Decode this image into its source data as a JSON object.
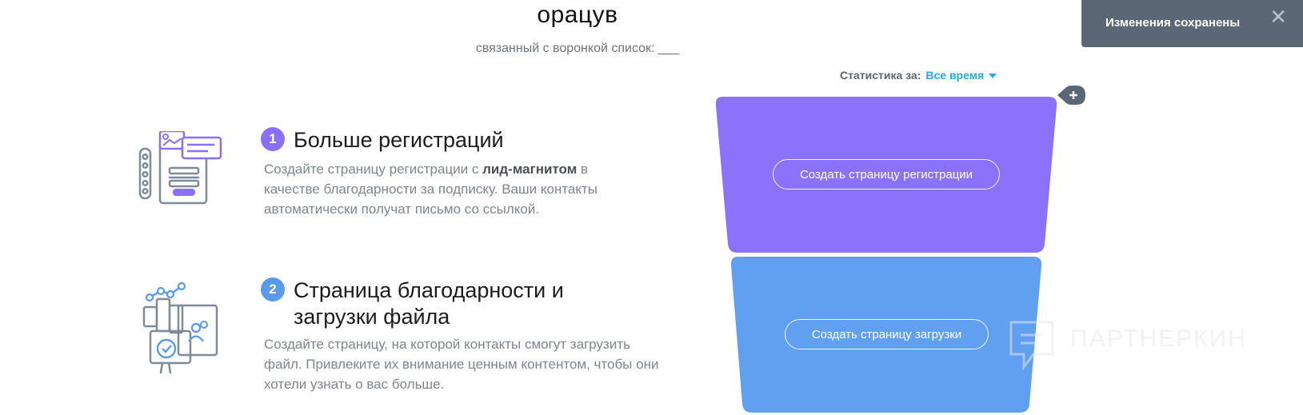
{
  "page": {
    "title": "орацув",
    "linked_list_label": "связанный с воронкой список:",
    "linked_list_value": "___"
  },
  "toast": {
    "message": "Изменения сохранены",
    "close_glyph": "✕"
  },
  "stats": {
    "label": "Статистика за:",
    "period": "Все время"
  },
  "steps": [
    {
      "number": "1",
      "title": "Больше регистраций",
      "desc_before": "Создайте страницу регистрации с ",
      "desc_bold": "лид-магнитом",
      "desc_after": " в качестве благодарности за подписку. Ваши контакты автоматически получат письмо со ссылкой.",
      "icon": "registration-form-icon",
      "color": "#8b6ff5"
    },
    {
      "number": "2",
      "title": "Страница благодарности и загрузки файла",
      "desc": "Создайте страницу, на которой контакты смогут загрузить файл. Привлеките их внимание ценным контентом, чтобы они хотели узнать о вас больше.",
      "icon": "download-page-icon",
      "color": "#5a9aeb"
    }
  ],
  "funnel": {
    "stage1_button": "Создать страницу регистрации",
    "stage2_button": "Создать страницу загрузки",
    "stage1_color": "#8b72fb",
    "stage2_color": "#619ff0"
  },
  "watermark": {
    "text": "ПАРТНЕРКИН"
  }
}
